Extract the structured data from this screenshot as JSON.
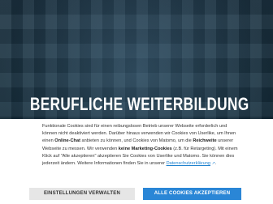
{
  "hero": {
    "title": "BERUFLICHE WEITERBILDUNG"
  },
  "cookie_banner": {
    "text_1": "Funktionale Cookies sind für einen reibungslosen Betrieb unserer Webseite erforderlich und können nicht deaktiviert werden. Darüber hinaus verwenden wir Cookies von Userlike, um Ihnen einen ",
    "strong_1": "Online-Chat",
    "text_2": " anbieten zu können, und Cookies von Matomo, um die ",
    "strong_2": "Reichweite",
    "text_3": " unserer Webseite zu messen. Wir verwenden ",
    "strong_3": "keine Marketing-Cookies",
    "text_4": " (z.B. für Retargeting). Mit einem Klick auf \"Alle akzeptieren\" akzeptieren Sie Cookies von Userlike und Matomo. Sie können dies jederzeit ändern. Weitere Informationen finden Sie in unserer ",
    "privacy_link": "Datenschutzerklärung",
    "privacy_link_icon": "external-link-icon",
    "text_5": ".",
    "settings_button": "EINSTELLUNGEN VERWALTEN",
    "accept_button": "ALLE COOKIES AKZEPTIEREN"
  },
  "colors": {
    "accent": "#2a86d6",
    "link": "#1f82cf",
    "secondary_button": "#e6e6e6"
  }
}
